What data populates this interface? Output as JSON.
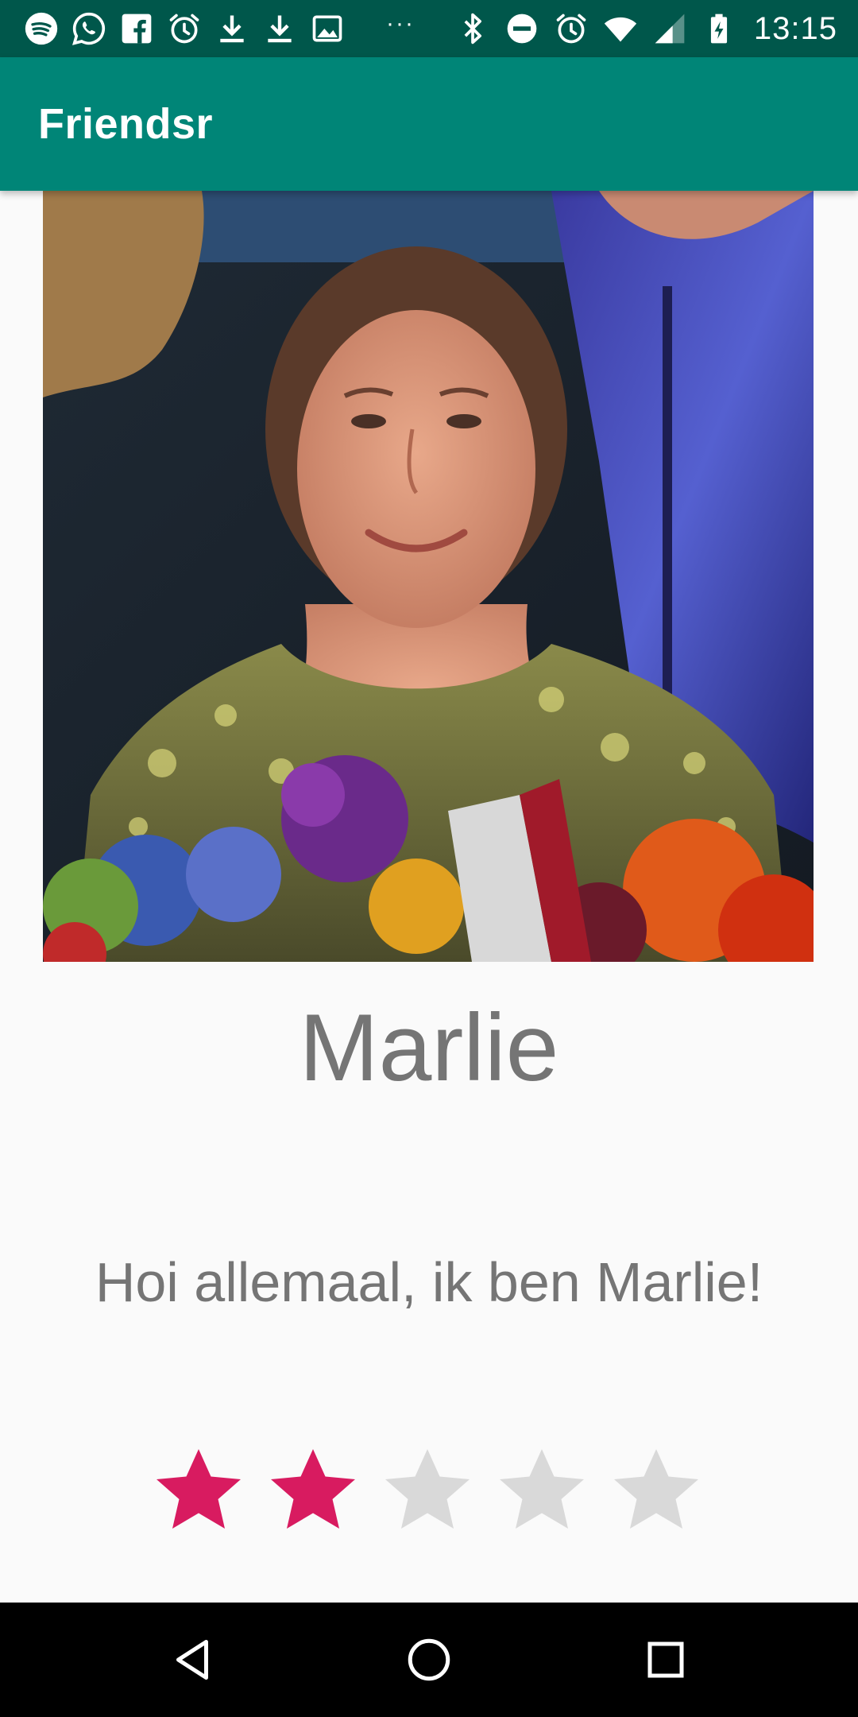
{
  "status_bar": {
    "time": "13:15",
    "left_icons": [
      "spotify-icon",
      "whatsapp-icon",
      "facebook-icon",
      "alarm-icon",
      "download-icon",
      "download-icon",
      "image-icon"
    ],
    "overflow": "···",
    "right_icons": [
      "bluetooth-icon",
      "do-not-disturb-icon",
      "alarm-icon",
      "wifi-icon",
      "cell-signal-icon",
      "battery-charging-icon"
    ]
  },
  "app_bar": {
    "title": "Friendsr"
  },
  "profile": {
    "name": "Marlie",
    "bio": "Hoi allemaal, ik ben Marlie!",
    "rating": 2,
    "rating_max": 5
  },
  "colors": {
    "status_bar": "#00574b",
    "app_bar": "#008577",
    "star_active": "#d81b60",
    "star_inactive": "#d9d9d9",
    "text": "#757575"
  },
  "nav_bar": {
    "buttons": [
      "back-icon",
      "home-icon",
      "recents-icon"
    ]
  }
}
